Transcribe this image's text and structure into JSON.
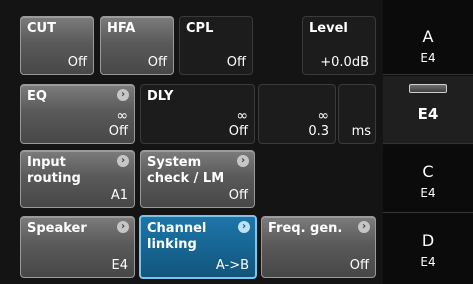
{
  "tiles": {
    "cut": {
      "label": "CUT",
      "value": "Off"
    },
    "hfa": {
      "label": "HFA",
      "value": "Off"
    },
    "cpl": {
      "label": "CPL",
      "value": "Off"
    },
    "level": {
      "label": "Level",
      "value": "+0.0dB"
    },
    "eq": {
      "label": "EQ",
      "value_top": "∞",
      "value": "Off"
    },
    "dly": {
      "label": "DLY",
      "value_top": "∞",
      "value": "Off",
      "value2_top": "∞",
      "value2": "0.3",
      "unit": "ms"
    },
    "input_routing": {
      "label": "Input\nrouting",
      "value": "A1"
    },
    "system_check": {
      "label": "System\ncheck / LM",
      "value": "Off"
    },
    "speaker": {
      "label": "Speaker",
      "value": "E4"
    },
    "channel_linking": {
      "label": "Channel\nlinking",
      "value": "A->B"
    },
    "freq_gen": {
      "label": "Freq. gen.",
      "value": "Off"
    }
  },
  "channels": [
    {
      "name": "A",
      "type": "E4"
    },
    {
      "name": "",
      "type": "E4"
    },
    {
      "name": "C",
      "type": "E4"
    },
    {
      "name": "D",
      "type": "E4"
    }
  ],
  "icons": {
    "arrow": "chevron-right-icon",
    "indicator": "channel-indicator-icon"
  },
  "colors": {
    "accent": "#1d76a9",
    "accent_border": "#7ec3ea",
    "tile_gray": "#5a5a5a",
    "background": "#141414"
  }
}
